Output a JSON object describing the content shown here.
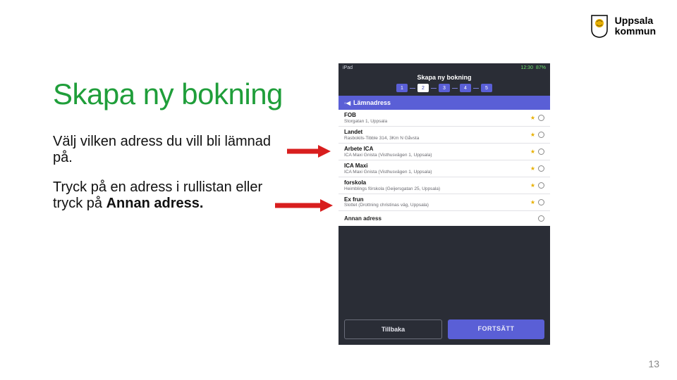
{
  "logo": {
    "line1": "Uppsala",
    "line2": "kommun"
  },
  "slide": {
    "title": "Skapa ny bokning",
    "para1": "Välj vilken adress du vill bli lämnad på.",
    "para2_prefix": "Tryck på en adress i rullistan eller tryck på ",
    "para2_bold": "Annan adress.",
    "page_number": "13"
  },
  "phone": {
    "status_left": "iPad",
    "status_time": "12:30",
    "status_batt": "87%",
    "title": "Skapa ny bokning",
    "steps": [
      "1",
      "2",
      "3",
      "4",
      "5"
    ],
    "active_step": 2,
    "section_header": "Lämnadress",
    "addresses": [
      {
        "name": "FOB",
        "sub": "Storgatan 1, Uppsala"
      },
      {
        "name": "Landet",
        "sub": "Rasbokils-Tibble 314, 3Km N Gåvsta"
      },
      {
        "name": "Arbete ICA",
        "sub": "ICA Maxi Gnista (Visthusvägen 1, Uppsala)"
      },
      {
        "name": "ICA Maxi",
        "sub": "ICA Maxi Gnista (Visthusvägen 1, Uppsala)"
      },
      {
        "name": "forskola",
        "sub": "Heimblings förskola (Geijersgatan 25, Uppsala)"
      },
      {
        "name": "Ex frun",
        "sub": "Slottet (Drottning christinas väg, Uppsala)"
      }
    ],
    "other_address": "Annan adress",
    "btn_back": "Tillbaka",
    "btn_next": "FORTSÄTT"
  }
}
